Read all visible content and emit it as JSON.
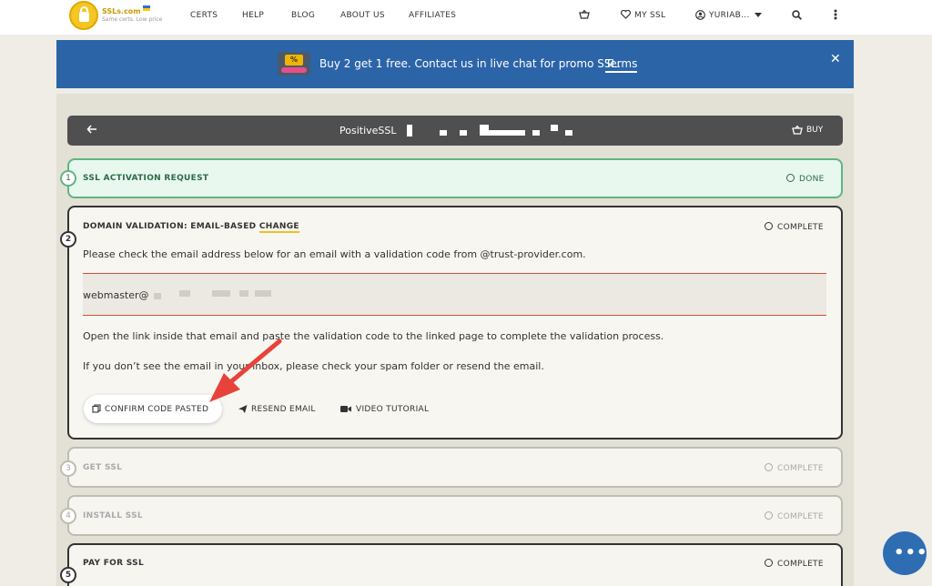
{
  "header": {
    "brand": "SSLs.com",
    "tagline": "Same certs. Low price",
    "nav": [
      "CERTS",
      "HELP",
      "BLOG",
      "ABOUT US",
      "AFFILIATES"
    ],
    "my_ssl": "MY SSL",
    "user": "YURIAB..."
  },
  "banner": {
    "icon_text": "%",
    "text": "Buy 2 get 1 free. Contact us in live chat for promo SSL.",
    "terms": "Terms",
    "close": "✕"
  },
  "product_bar": {
    "title": "PositiveSSL",
    "buy": "BUY"
  },
  "steps": [
    {
      "number": "1",
      "title": "SSL ACTIVATION REQUEST",
      "status": "DONE"
    },
    {
      "number": "2",
      "title_prefix": "DOMAIN VALIDATION: EMAIL-BASED ",
      "title_accent": "CHANGE",
      "status": "COMPLETE",
      "instruction": "Please check the email address below for an email with a validation code from @trust-provider.com.",
      "email": "webmaster@",
      "line2": "Open the link inside that email and paste the validation code to the linked page to complete the validation process.",
      "line3": "If you don’t see the email in your inbox, please check your spam folder or resend the email.",
      "actions": {
        "confirm": "CONFIRM CODE PASTED",
        "resend": "RESEND EMAIL",
        "video": "VIDEO TUTORIAL"
      }
    },
    {
      "number": "3",
      "title": "GET SSL",
      "status": "COMPLETE"
    },
    {
      "number": "4",
      "title": "INSTALL SSL",
      "status": "COMPLETE"
    },
    {
      "number": "5",
      "title": "PAY FOR SSL",
      "status": "COMPLETE"
    }
  ],
  "colors": {
    "banner": "#2c64a8",
    "done": "#5fb582",
    "arrow": "#e8433b"
  }
}
